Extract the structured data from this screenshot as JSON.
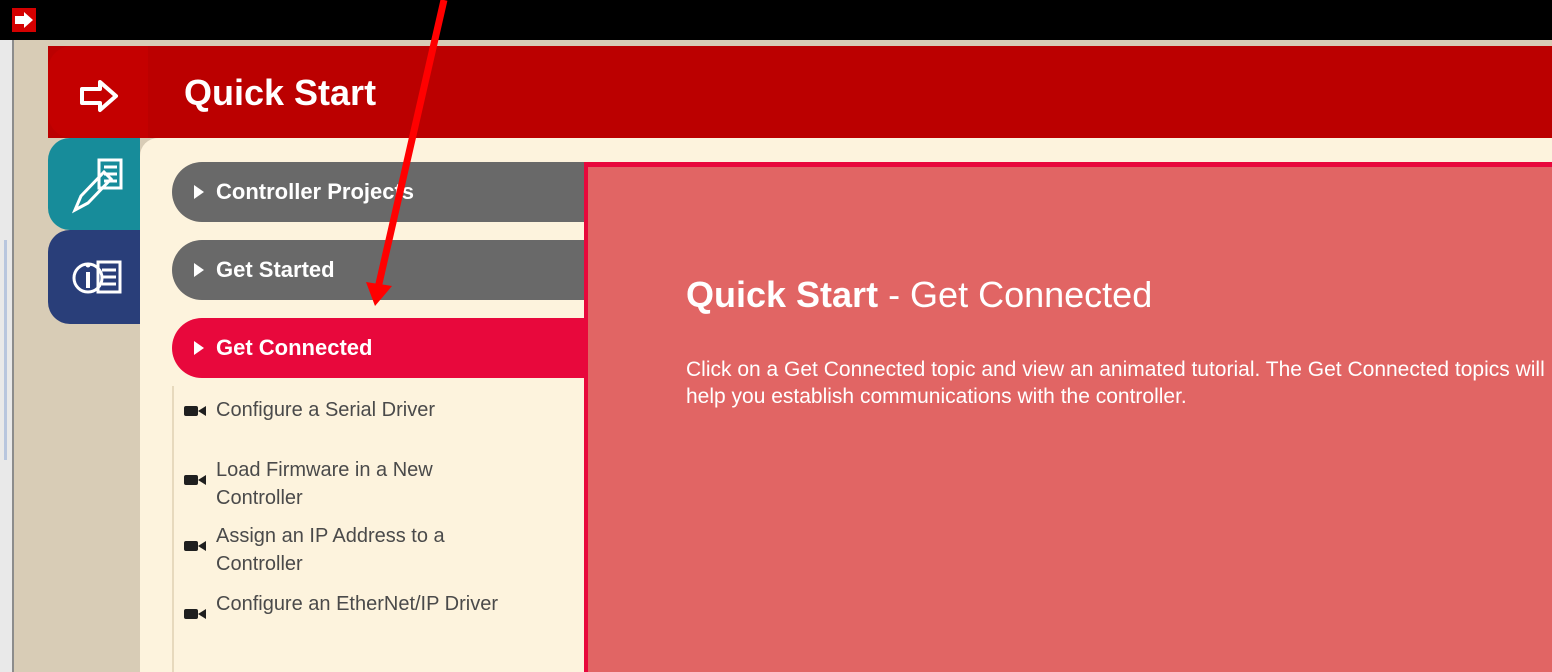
{
  "header": {
    "title": "Quick Start"
  },
  "side_tabs": [
    {
      "name": "Quick Start",
      "icon": "right-arrow-icon",
      "color": "#bb0000"
    },
    {
      "name": "Tools",
      "icon": "pencil-list-icon",
      "color": "#178c9a"
    },
    {
      "name": "Info",
      "icon": "info-list-icon",
      "color": "#293e79"
    }
  ],
  "nav": {
    "items": [
      {
        "label": "Controller Projects",
        "state": "collapsed"
      },
      {
        "label": "Get Started",
        "state": "collapsed"
      },
      {
        "label": "Get Connected",
        "state": "active"
      }
    ],
    "sub_items": [
      {
        "label": "Configure a Serial Driver",
        "icon": "video-camera-icon"
      },
      {
        "label": "Load Firmware in a New Controller",
        "icon": "video-camera-icon"
      },
      {
        "label": "Assign an IP Address to a Controller",
        "icon": "video-camera-icon"
      },
      {
        "label": "Configure an EtherNet/IP Driver",
        "icon": "video-camera-icon"
      }
    ]
  },
  "content": {
    "heading_bold": "Quick Start",
    "heading_rest": " - Get Connected",
    "description": "Click on a Get Connected topic and view an animated tutorial. The Get Connected topics will help you establish communications with the controller."
  },
  "colors": {
    "header_red": "#bb0000",
    "active_red": "#e8083c",
    "panel_salmon": "#e16564",
    "nav_grey": "#696969",
    "panel_cream": "#fdf3dd",
    "annotation_red": "#ff0000"
  }
}
